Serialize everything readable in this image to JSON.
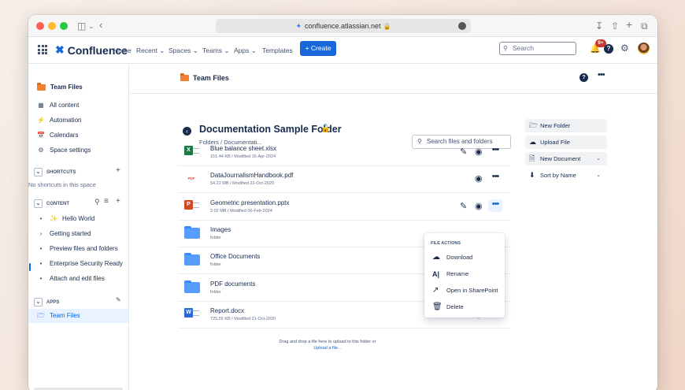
{
  "browser": {
    "url": "confluence.atlassian.net",
    "colors": {
      "close": "#fe5f57",
      "min": "#febc2e",
      "max": "#28c840"
    }
  },
  "topnav": {
    "logo": "Confluence",
    "items": [
      "Home",
      "Recent ⌄",
      "Spaces ⌄",
      "Teams ⌄",
      "Apps ⌄",
      "Templates"
    ],
    "create": "+ Create",
    "search_placeholder": "Search",
    "notification_count": "9+"
  },
  "sidebar": {
    "space_title": "Team Files",
    "items": [
      {
        "icon": "grid-icon",
        "label": "All content"
      },
      {
        "icon": "lightning-icon",
        "label": "Automation"
      },
      {
        "icon": "calendar-icon",
        "label": "Calendars"
      },
      {
        "icon": "gear-icon",
        "label": "Space settings"
      }
    ],
    "shortcuts_header": "SHORTCUTS",
    "shortcuts_empty": "No shortcuts in this space",
    "content_header": "CONTENT",
    "content_items": [
      {
        "bullet": "•",
        "label": "Hello World",
        "emoji": true
      },
      {
        "bullet": "›",
        "label": "Getting started"
      },
      {
        "bullet": "•",
        "label": "Preview files and folders"
      },
      {
        "bullet": "•",
        "label": "Enterprise Security Ready"
      },
      {
        "bullet": "•",
        "label": "Attach and edit files"
      }
    ],
    "apps_header": "APPS",
    "apps_item": "Team Files"
  },
  "space_header": {
    "title": "Team Files"
  },
  "folder": {
    "title": "Documentation Sample Folder",
    "breadcrumb": "Folders / Documentati...",
    "search_placeholder": "Search files and folders"
  },
  "files": [
    {
      "name": "Blue balance sheet.xlsx",
      "meta": "151.44 KB / Modified 16-Apr-2024",
      "type": "xlsx"
    },
    {
      "name": "DataJournalismHandbook.pdf",
      "meta": "54.22 MB / Modified 21-Oct-2020",
      "type": "pdf"
    },
    {
      "name": "Geometric presentation.pptx",
      "meta": "2.02 MB / Modified 06-Feb-2024",
      "type": "pptx"
    },
    {
      "name": "Images",
      "meta": "folder",
      "type": "folder"
    },
    {
      "name": "Office Documents",
      "meta": "folder",
      "type": "folder"
    },
    {
      "name": "PDF documents",
      "meta": "folder",
      "type": "folder"
    },
    {
      "name": "Report.docx",
      "meta": "725.55 KB / Modified 21-Oct-2020",
      "type": "docx"
    }
  ],
  "drop_zone": {
    "text": "Drag and drop a file here to upload to this folder or",
    "link": "Upload a file..."
  },
  "actions": {
    "new_folder": "New Folder",
    "upload_file": "Upload File",
    "new_document": "New Document",
    "sort": "Sort by Name"
  },
  "file_menu": {
    "header": "FILE ACTIONS",
    "items": [
      "Download",
      "Rename",
      "Open in SharePoint",
      "Delete"
    ]
  },
  "colors": {
    "brand": "#1868db",
    "xlsx": "#1d7a45",
    "pptx": "#d04a25",
    "docx": "#2b6bd6",
    "folder": "#579dff",
    "space": "#f0822f"
  }
}
